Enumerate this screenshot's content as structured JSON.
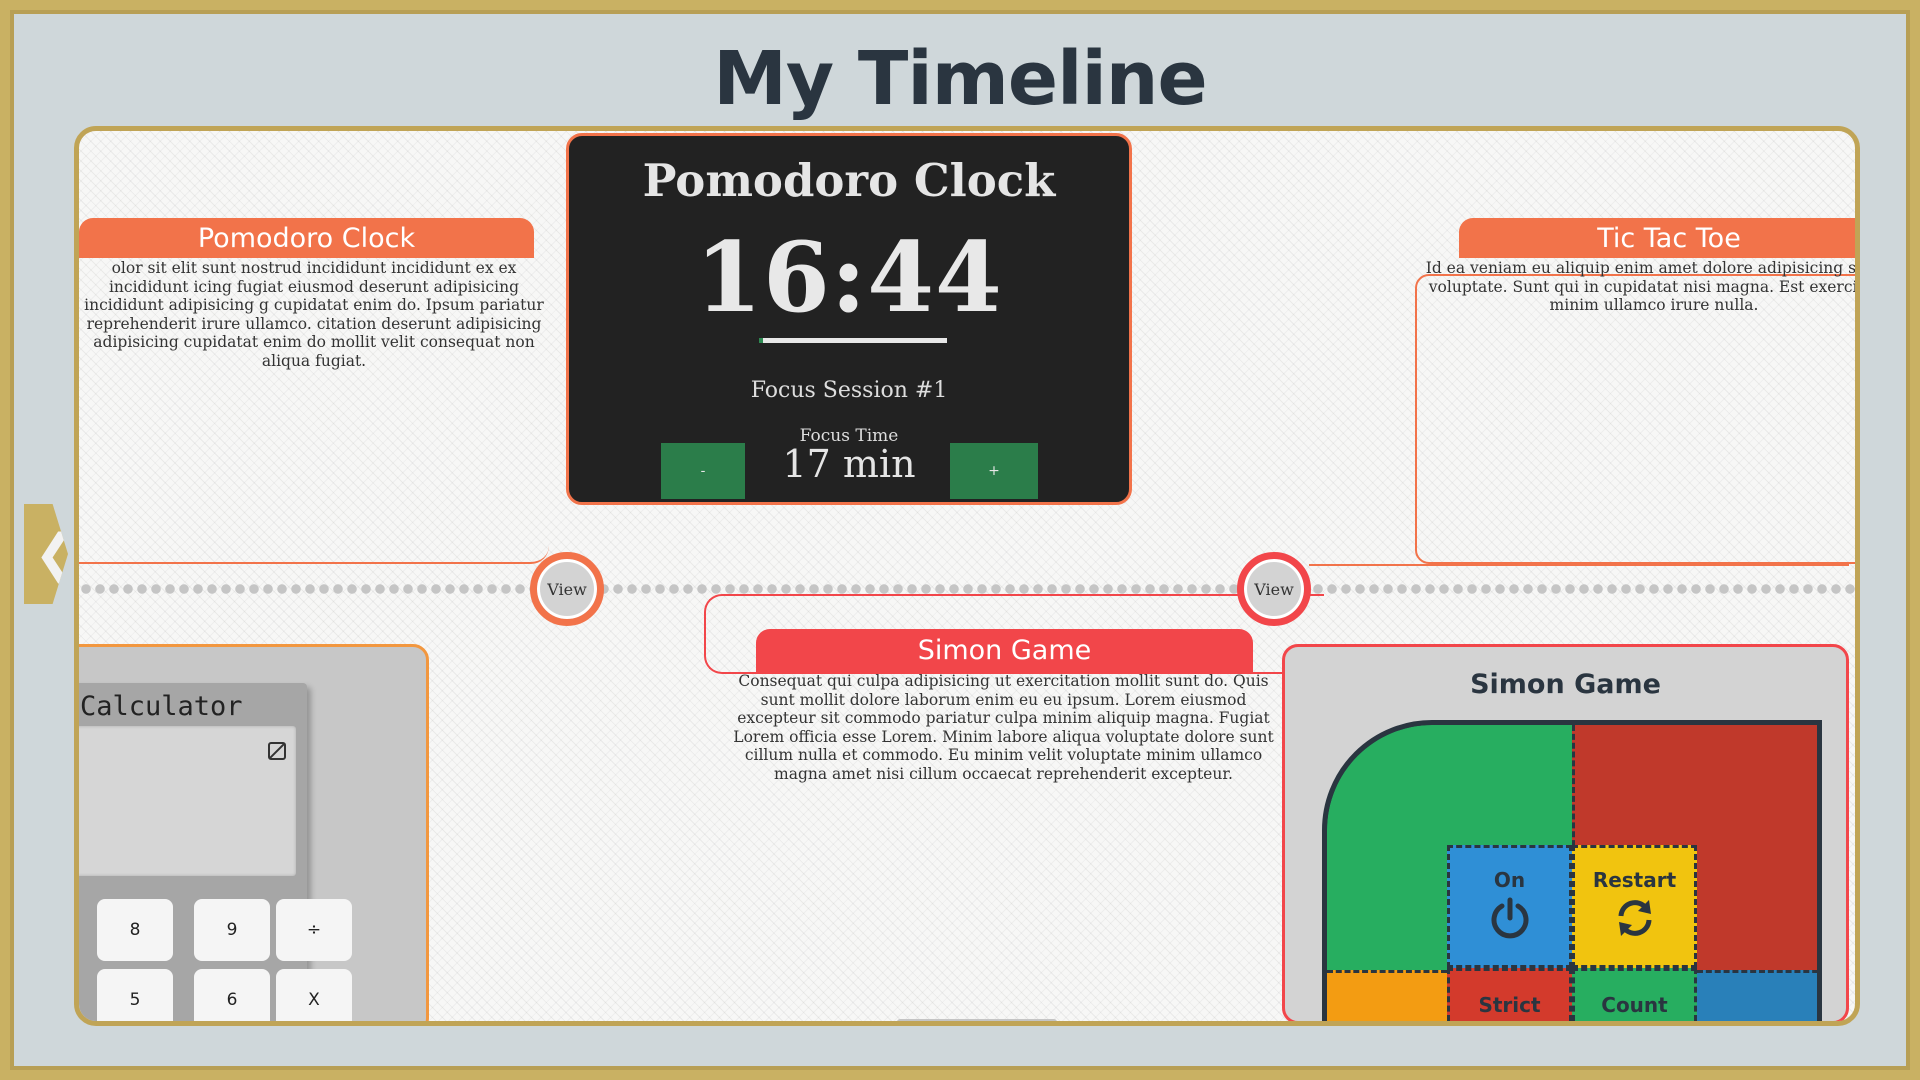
{
  "page_title": "My Timeline",
  "events": {
    "pomodoro": {
      "title": "Pomodoro Clock",
      "text": "olor sit elit sunt nostrud incididunt incididunt ex ex incididunt icing fugiat eiusmod deserunt adipisicing incididunt adipisicing g cupidatat enim do. Ipsum pariatur reprehenderit irure ullamco. citation deserunt adipisicing adipisicing cupidatat enim do mollit velit consequat non aliqua fugiat."
    },
    "tictactoe": {
      "title": "Tic Tac Toe",
      "text": "Id ea veniam eu aliquip enim amet dolore adipisicing sunt voluptate. Sunt qui in cupidatat nisi magna. Est exercitat minim ullamco irure nulla."
    },
    "simon": {
      "title": "Simon Game",
      "text": "Consequat qui culpa adipisicing ut exercitation mollit sunt do. Quis sunt mollit dolore laborum enim eu eu ipsum. Lorem eiusmod excepteur sit commodo pariatur culpa minim aliquip magna. Fugiat Lorem officia esse Lorem. Minim labore aliqua voluptate dolore sunt cillum nulla et commodo. Eu minim velit voluptate minim ullamco magna amet nisi cillum occaecat reprehenderit excepteur."
    }
  },
  "view_buttons": [
    "View",
    "View"
  ],
  "pomodoro_preview": {
    "title": "Pomodoro Clock",
    "time": "16:44",
    "progress": 0.02,
    "session": "Focus Session #1",
    "focus_label": "Focus Time",
    "focus_value": "17 min",
    "minus": "-",
    "plus": "+"
  },
  "calculator_preview": {
    "title": "Calculator",
    "keys": [
      "8",
      "9",
      "÷",
      "5",
      "6",
      "X"
    ]
  },
  "simon_preview": {
    "title": "Simon Game",
    "on": "On",
    "restart": "Restart",
    "strict": "Strict",
    "count": "Count"
  },
  "colors": {
    "accent_orange": "#f2734a",
    "accent_red": "#f2464a",
    "frame_gold": "#c0a456",
    "pomo_green": "#2b7d4a"
  }
}
